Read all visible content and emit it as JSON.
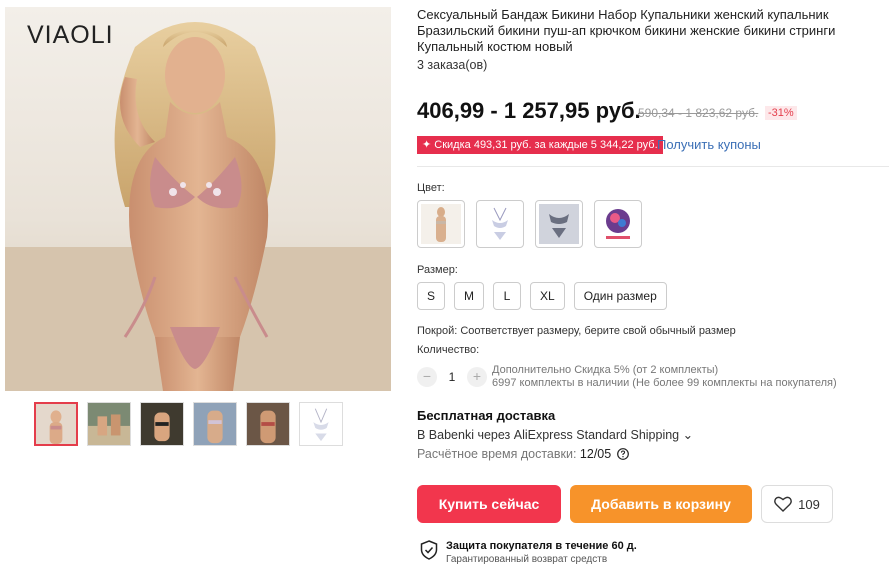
{
  "gallery": {
    "brand": "VIAOLI",
    "thumbnail_count": 6
  },
  "product": {
    "title": "Сексуальный Бандаж Бикини Набор Купальники женский купальник Бразильский бикини пуш-ап крючком бикини женские бикини стринги Купальный костюм новый",
    "orders": "3 заказа(ов)",
    "price": "406,99 - 1 257,95 руб.",
    "old_price": "590,34 - 1 823,62 руб.",
    "discount": "-31%",
    "coupon": "✦ Скидка 493,31 руб. за каждые 5 344,22 руб.",
    "coupon_link": "Получить купоны"
  },
  "options": {
    "color_label": "Цвет:",
    "colors": [
      "color-1",
      "color-2",
      "color-3",
      "color-4"
    ],
    "size_label": "Размер:",
    "sizes": [
      "S",
      "M",
      "L",
      "XL",
      "Один размер"
    ],
    "fit": "Покрой: Соответствует размеру, берите свой обычный размер",
    "qty_label": "Количество:",
    "qty_value": "1",
    "qty_minus": "−",
    "qty_plus": "+",
    "qty_discount": "Дополнительно Скидка 5% (от 2 комплекты)",
    "qty_stock": "6997 комплекты в наличии (Не более 99 комплекты на покупателя)"
  },
  "shipping": {
    "title": "Бесплатная доставка",
    "via": "В Babenki через AliExpress Standard Shipping ⌄",
    "time_label": "Расчётное время доставки:",
    "time_value": "12/05"
  },
  "actions": {
    "buy": "Купить сейчас",
    "cart": "Добавить в корзину",
    "wishlist_count": "109"
  },
  "protection": {
    "title": "Защита покупателя в течение 60 д.",
    "subtitle": "Гарантированный возврат средств"
  },
  "colors": {
    "price_red": "#e43d4b",
    "buy_button": "#f2364d",
    "cart_button": "#f7932a",
    "link": "#3b6fb6"
  }
}
